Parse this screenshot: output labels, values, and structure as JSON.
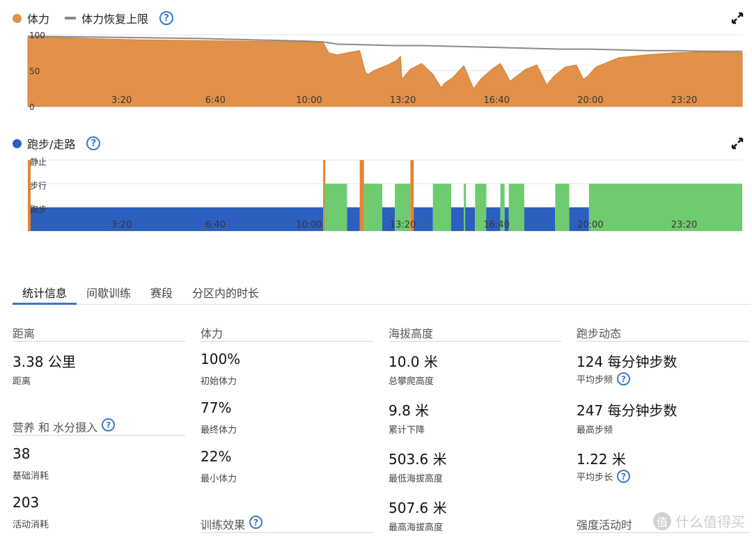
{
  "chart1": {
    "legend_stamina": "体力",
    "legend_limit": "体力恢复上限",
    "help": "?",
    "colors": {
      "stamina": "#e2914a",
      "limit": "#8a8a8a",
      "grid": "#e6e6e6"
    },
    "y_ticks": [
      "100",
      "50",
      "0"
    ],
    "x_ticks": [
      "3:20",
      "6:40",
      "10:00",
      "13:20",
      "16:40",
      "20:00",
      "23:20"
    ]
  },
  "chart2": {
    "legend": "跑步/走路",
    "help": "?",
    "colors": {
      "run": "#2d5fbf",
      "walk": "#6fcb6f",
      "still": "#e58235"
    },
    "y_labels": [
      "静止",
      "步行",
      "跑步"
    ],
    "x_ticks": [
      "3:20",
      "6:40",
      "10:00",
      "13:20",
      "16:40",
      "20:00",
      "23:20"
    ]
  },
  "chart_data": [
    {
      "type": "area",
      "x_unit": "hour of day",
      "xlim": [
        0,
        25.4
      ],
      "ylim": [
        0,
        100
      ],
      "series": [
        {
          "name": "体力",
          "x": [
            0,
            0.5,
            2,
            4,
            6,
            8,
            10,
            10.5,
            10.7,
            11,
            11.5,
            11.8,
            12.0,
            12.1,
            12.3,
            12.8,
            13.1,
            13.25,
            13.3,
            13.6,
            14,
            14.4,
            14.7,
            14.8,
            15.1,
            15.5,
            15.85,
            16.1,
            16.5,
            16.8,
            17.15,
            17.3,
            17.7,
            18.1,
            18.45,
            18.7,
            19.1,
            19.5,
            19.75,
            19.9,
            20.2,
            21,
            22,
            23,
            24,
            25.4
          ],
          "values": [
            97,
            97,
            95,
            93,
            92,
            91,
            90,
            89,
            75,
            72,
            76,
            78,
            48,
            45,
            50,
            58,
            64,
            70,
            38,
            52,
            60,
            45,
            26,
            32,
            40,
            57,
            25,
            38,
            52,
            60,
            35,
            40,
            52,
            58,
            30,
            42,
            55,
            58,
            38,
            42,
            55,
            68,
            72,
            75,
            76,
            75
          ]
        },
        {
          "name": "体力恢复上限",
          "x": [
            0,
            2,
            4,
            6,
            8,
            10,
            10.5,
            11,
            12,
            13,
            14,
            15,
            16,
            17,
            18,
            19,
            20,
            21,
            22,
            23,
            24,
            25.4
          ],
          "values": [
            98,
            97,
            96,
            95,
            93,
            91,
            90,
            87,
            86,
            85,
            85,
            84,
            83,
            82,
            81,
            80,
            80,
            79,
            78,
            78,
            77,
            77
          ]
        }
      ]
    },
    {
      "type": "bar",
      "x_unit": "hour of day",
      "xlim": [
        0,
        25.4
      ],
      "states": [
        "静止",
        "步行",
        "跑步"
      ],
      "segments": [
        {
          "state": "静止",
          "start": 0.0,
          "end": 0.1
        },
        {
          "state": "跑步",
          "start": 0.1,
          "end": 10.5
        },
        {
          "state": "静止",
          "start": 10.5,
          "end": 10.55
        },
        {
          "state": "步行",
          "start": 10.55,
          "end": 11.35
        },
        {
          "state": "跑步",
          "start": 11.35,
          "end": 11.8
        },
        {
          "state": "静止",
          "start": 11.8,
          "end": 11.95
        },
        {
          "state": "步行",
          "start": 11.95,
          "end": 12.6
        },
        {
          "state": "跑步",
          "start": 12.6,
          "end": 13.05
        },
        {
          "state": "步行",
          "start": 13.05,
          "end": 13.6
        },
        {
          "state": "静止",
          "start": 13.6,
          "end": 13.72
        },
        {
          "state": "跑步",
          "start": 13.72,
          "end": 14.4
        },
        {
          "state": "步行",
          "start": 14.4,
          "end": 15.05
        },
        {
          "state": "跑步",
          "start": 15.05,
          "end": 15.5
        },
        {
          "state": "步行",
          "start": 15.5,
          "end": 15.55
        },
        {
          "state": "跑步",
          "start": 15.55,
          "end": 15.9
        },
        {
          "state": "步行",
          "start": 15.9,
          "end": 16.3
        },
        {
          "state": "跑步",
          "start": 16.3,
          "end": 16.8
        },
        {
          "state": "步行",
          "start": 16.8,
          "end": 16.95
        },
        {
          "state": "跑步",
          "start": 16.95,
          "end": 17.1
        },
        {
          "state": "步行",
          "start": 17.1,
          "end": 17.65
        },
        {
          "state": "跑步",
          "start": 17.65,
          "end": 18.75
        },
        {
          "state": "步行",
          "start": 18.75,
          "end": 19.25
        },
        {
          "state": "跑步",
          "start": 19.25,
          "end": 19.95
        },
        {
          "state": "步行",
          "start": 19.95,
          "end": 25.4
        }
      ]
    }
  ],
  "tabs": [
    "统计信息",
    "间歇训练",
    "赛段",
    "分区内的时长"
  ],
  "stats": {
    "distance": {
      "head": "距离",
      "value": "3.38 公里",
      "label": "距离"
    },
    "nutrition": {
      "head": "营养 和 水分摄入",
      "base_value": "38",
      "base_label": "基础消耗",
      "active_value": "203",
      "active_label": "活动消耗"
    },
    "stamina": {
      "head": "体力",
      "start_value": "100%",
      "start_label": "初始体力",
      "end_value": "77%",
      "end_label": "最终体力",
      "min_value": "22%",
      "min_label": "最小体力",
      "training_effect": "训练效果"
    },
    "elevation": {
      "head": "海拔高度",
      "gain_value": "10.0 米",
      "gain_label": "总攀爬高度",
      "loss_value": "9.8 米",
      "loss_label": "累计下降",
      "min_value": "503.6 米",
      "min_label": "最低海拔高度",
      "max_value": "507.6 米",
      "max_label": "最高海拔高度"
    },
    "dynamics": {
      "head": "跑步动态",
      "cadence_value": "124 每分钟步数",
      "cadence_label": "平均步频",
      "max_cadence_value": "247 每分钟步数",
      "max_cadence_label": "最高步频",
      "stride_value": "1.22 米",
      "stride_label": "平均步长",
      "intensity": "强度活动时"
    }
  },
  "watermark": {
    "badge": "值",
    "text": "什么值得买"
  }
}
